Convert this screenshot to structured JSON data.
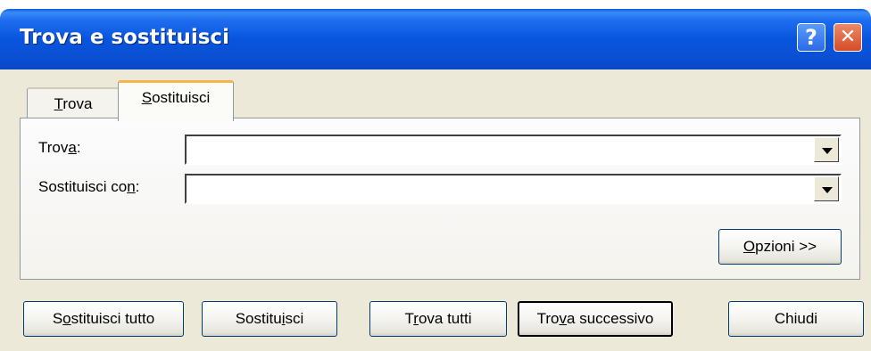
{
  "window": {
    "title": "Trova e sostituisci",
    "help_glyph": "?",
    "close_glyph": "✕"
  },
  "tabs": [
    {
      "label": "Trova",
      "mnemonic_index": 0,
      "selected": false
    },
    {
      "label": "Sostituisci",
      "mnemonic_index": 0,
      "selected": true
    }
  ],
  "find": {
    "label": "Trova:",
    "value": "",
    "placeholder": ""
  },
  "replace": {
    "label": "Sostituisci con:",
    "value": "",
    "placeholder": ""
  },
  "buttons": {
    "options": "Opzioni >>",
    "replace_all": "Sostituisci tutto",
    "replace": "Sostituisci",
    "find_all": "Trova tutti",
    "find_next": "Trova successivo",
    "close": "Chiudi"
  },
  "colors": {
    "titlebar": "#0a50d4",
    "dialog_bg": "#ece9d8",
    "tab_highlight": "#f6b54a"
  }
}
